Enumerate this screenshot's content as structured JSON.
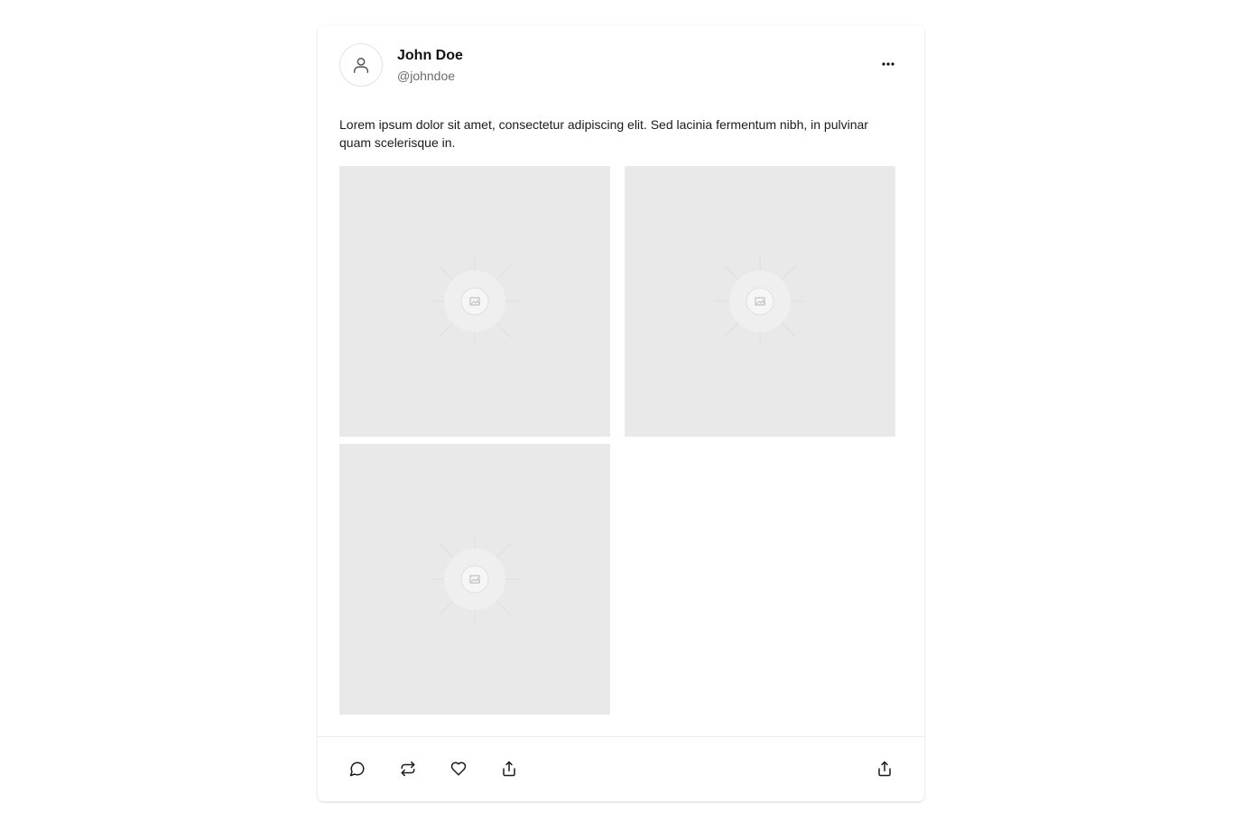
{
  "post": {
    "author": {
      "name": "John Doe",
      "handle": "@johndoe"
    },
    "text": "Lorem ipsum dolor sit amet, consectetur adipiscing elit. Sed lacinia fermentum nibh, in pulvinar quam scelerisque in.",
    "images": [
      {
        "icon": "image-placeholder-icon"
      },
      {
        "icon": "image-placeholder-icon"
      },
      {
        "icon": "image-placeholder-icon"
      }
    ]
  },
  "icons": {
    "avatar": "user-icon",
    "more": "more-horizontal-icon",
    "comment": "comment-icon",
    "repost": "repost-icon",
    "like": "heart-icon",
    "share": "share-icon"
  },
  "colors": {
    "placeholder": "#e9e9e9",
    "muted_text": "#6b6b6b",
    "icon": "#1a1a1a"
  }
}
